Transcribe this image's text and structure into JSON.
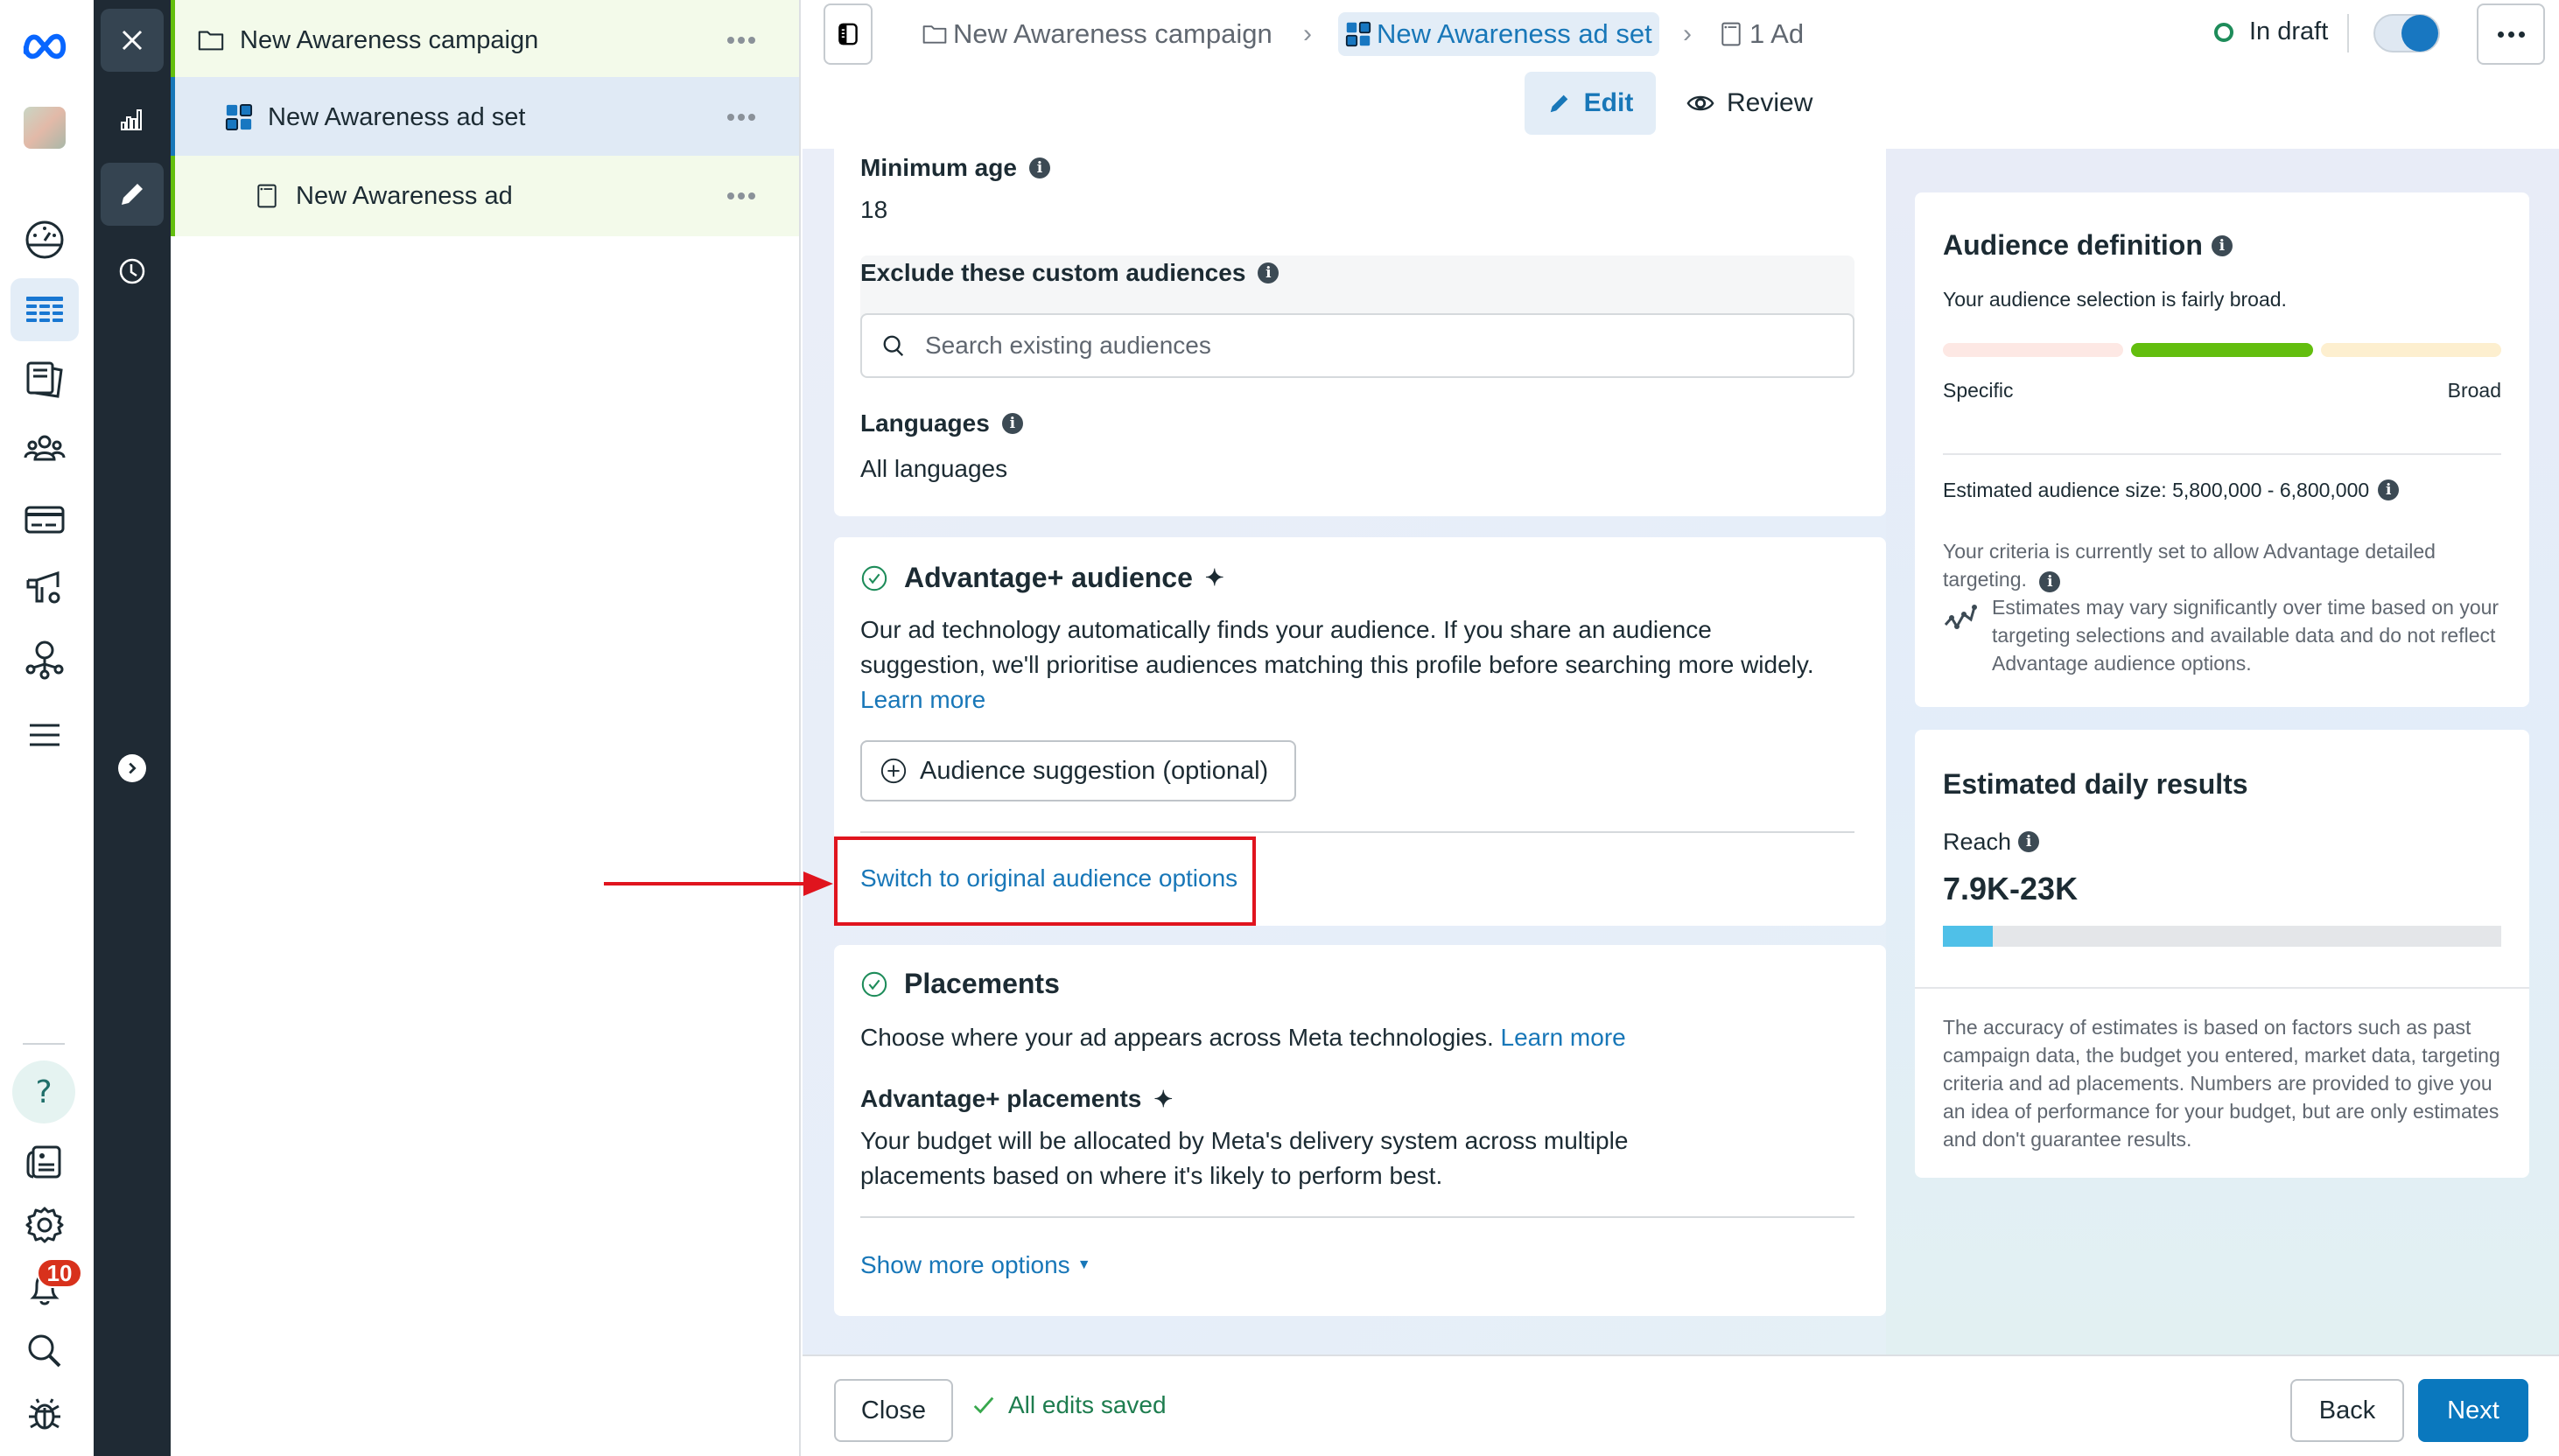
{
  "rail": {
    "items": [
      {
        "name": "meta-logo",
        "icon": "meta-infinity-icon"
      },
      {
        "name": "account-avatar",
        "icon": "avatar-icon"
      },
      {
        "name": "dashboard",
        "icon": "speedometer-icon"
      },
      {
        "name": "campaigns",
        "icon": "table-grid-icon",
        "active": true
      },
      {
        "name": "pages",
        "icon": "documents-icon"
      },
      {
        "name": "audiences",
        "icon": "people-icon"
      },
      {
        "name": "billing",
        "icon": "credit-card-icon"
      },
      {
        "name": "ads-settings",
        "icon": "megaphone-gear-icon"
      },
      {
        "name": "business-assets",
        "icon": "network-icon"
      },
      {
        "name": "all-tools",
        "icon": "hamburger-menu-icon"
      },
      {
        "name": "help",
        "icon": "question-icon"
      },
      {
        "name": "news",
        "icon": "newspaper-icon"
      },
      {
        "name": "settings",
        "icon": "gear-icon"
      },
      {
        "name": "notifications",
        "icon": "bell-icon",
        "badge": "10"
      },
      {
        "name": "search",
        "icon": "search-icon"
      },
      {
        "name": "report-bug",
        "icon": "bug-icon"
      }
    ]
  },
  "dark_rail": {
    "items": [
      {
        "name": "close",
        "icon": "close-icon"
      },
      {
        "name": "reports",
        "icon": "bar-chart-icon"
      },
      {
        "name": "edit",
        "icon": "pencil-icon",
        "active": true
      },
      {
        "name": "history",
        "icon": "clock-icon"
      }
    ],
    "expand_icon": "chevron-right-icon"
  },
  "tree": {
    "items": [
      {
        "label": "New Awareness campaign",
        "icon": "folder-icon",
        "level": 0,
        "selected": false
      },
      {
        "label": "New Awareness ad set",
        "icon": "ad-set-grid-icon",
        "level": 1,
        "selected": true
      },
      {
        "label": "New Awareness ad",
        "icon": "ad-page-icon",
        "level": 2,
        "selected": false
      }
    ]
  },
  "header": {
    "breadcrumb": [
      {
        "label": "New Awareness campaign",
        "icon": "folder-icon"
      },
      {
        "label": "New Awareness ad set",
        "icon": "ad-set-grid-icon",
        "current": true
      },
      {
        "label": "1 Ad",
        "icon": "ad-page-icon"
      }
    ],
    "status": "In draft",
    "toggle_on": true,
    "tabs": [
      {
        "label": "Edit",
        "icon": "pencil-icon",
        "active": true
      },
      {
        "label": "Review",
        "icon": "eye-icon",
        "active": false
      }
    ]
  },
  "audience_card": {
    "min_age_label": "Minimum age",
    "min_age_value": "18",
    "exclude_label": "Exclude these custom audiences",
    "search_placeholder": "Search existing audiences",
    "languages_label": "Languages",
    "languages_value": "All languages"
  },
  "advantage_card": {
    "title": "Advantage+ audience",
    "body": "Our ad technology automatically finds your audience. If you share an audience suggestion, we'll prioritise audiences matching this profile before searching more widely.",
    "learn_more": "Learn more",
    "suggestion_button": "Audience suggestion (optional)",
    "switch_link": "Switch to original audience options"
  },
  "placements_card": {
    "title": "Placements",
    "body": "Choose where your ad appears across Meta technologies.",
    "learn_more": "Learn more",
    "adv_title": "Advantage+ placements",
    "adv_body": "Your budget will be allocated by Meta's delivery system across multiple placements based on where it's likely to perform best.",
    "show_more": "Show more options"
  },
  "audience_definition": {
    "title": "Audience definition",
    "summary": "Your audience selection is fairly broad.",
    "meter_segment_active": 2,
    "meter_segments": 3,
    "colors": {
      "specific": "#fde8e4",
      "active": "#63be0e",
      "broad": "#fdefcf"
    },
    "left_label": "Specific",
    "right_label": "Broad",
    "size_label": "Estimated audience size: 5,800,000 - 6,800,000",
    "criteria_text": "Your criteria is currently set to allow Advantage detailed targeting.",
    "estimates_note": "Estimates may vary significantly over time based on your targeting selections and available data and do not reflect Advantage audience options."
  },
  "daily_results": {
    "title": "Estimated daily results",
    "reach_label": "Reach",
    "reach_value": "7.9K-23K",
    "reach_bar_fraction": 0.09,
    "reach_bar_color": "#4fc0e8",
    "disclaimer": "The accuracy of estimates is based on factors such as past campaign data, the budget you entered, market data, targeting criteria and ad placements. Numbers are provided to give you an idea of performance for your budget, but are only estimates and don't guarantee results."
  },
  "footer": {
    "close": "Close",
    "saved": "All edits saved",
    "back": "Back",
    "next": "Next"
  },
  "colors": {
    "brand_blue": "#0a78be",
    "link": "#1877b8",
    "annotation_red": "#e0141e",
    "dark_rail": "#1f2a34",
    "success_green": "#1e8c5a"
  }
}
